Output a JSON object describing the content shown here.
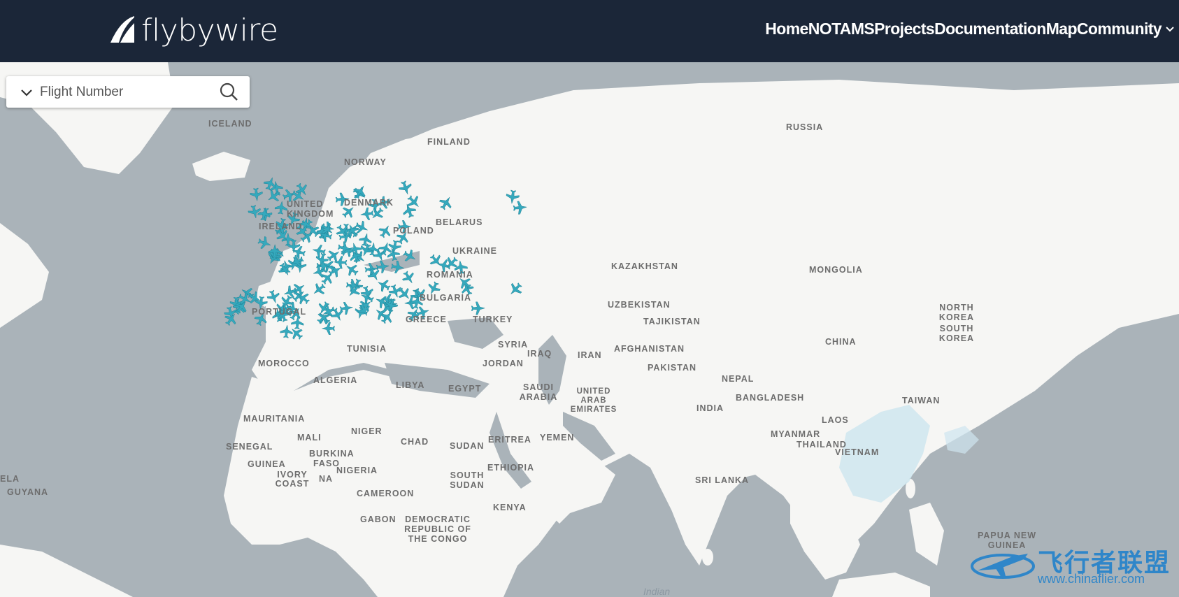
{
  "brand": {
    "name": "flybywire"
  },
  "nav": {
    "items": [
      "Home",
      "NOTAMS",
      "Projects",
      "Documentation",
      "Map",
      "Community"
    ]
  },
  "search": {
    "placeholder": "Flight Number",
    "value": ""
  },
  "map": {
    "labels": {
      "iceland": "ICELAND",
      "finland": "FINLAND",
      "norway": "NORWAY",
      "russia": "RUSSIA",
      "belarus": "BELARUS",
      "ukraine": "UKRAINE",
      "kazakhstan": "KAZAKHSTAN",
      "mongolia": "MONGOLIA",
      "uzbekistan": "UZBEKISTAN",
      "tajikistan": "TAJIKISTAN",
      "turkey": "TURKEY",
      "greece": "GREECE",
      "bulgaria": "BULGARIA",
      "denmark": "DENMARK",
      "poland": "POLAND",
      "ireland": "IRELAND",
      "portugal": "PORTUGAL",
      "united_kingdom": "UNITED KINGDOM",
      "romania": "ROMANIA",
      "north_korea": "NORTH KOREA",
      "south_korea": "SOUTH KOREA",
      "china": "CHINA",
      "tunisia": "TUNISIA",
      "syria": "SYRIA",
      "iraq": "IRAQ",
      "iran": "IRAN",
      "afghanistan": "AFGHANISTAN",
      "pakistan": "PAKISTAN",
      "morocco": "MOROCCO",
      "jordan": "JORDAN",
      "algeria": "ALGERIA",
      "libya": "LIBYA",
      "egypt": "EGYPT",
      "saudi_arabia": "SAUDI ARABIA",
      "nepal": "NEPAL",
      "uae": "UNITED ARAB EMIRATES",
      "bangladesh": "BANGLADESH",
      "taiwan": "TAIWAN",
      "india": "INDIA",
      "mauritania": "MAURITANIA",
      "niger": "NIGER",
      "mali": "MALI",
      "chad": "CHAD",
      "sudan": "SUDAN",
      "eritrea": "ERITREA",
      "yemen": "YEMEN",
      "laos": "LAOS",
      "myanmar": "MYANMAR",
      "thailand": "THAILAND",
      "senegal": "SENEGAL",
      "burkina_faso": "BURKINA FASO",
      "guinea": "GUINEA",
      "vietnam": "VIETNAM",
      "nigeria": "NIGERIA",
      "ethiopia": "ETHIOPIA",
      "ivory_coast": "IVORY COAST",
      "ghana": "NA",
      "south_sudan": "SOUTH SUDAN",
      "sri_lanka": "SRI LANKA",
      "venezuela": "ELA",
      "guyana": "GUYANA",
      "cameroon": "CAMEROON",
      "kenya": "KENYA",
      "gabon": "GABON",
      "drc": "DEMOCRATIC REPUBLIC OF THE CONGO",
      "papua_new_guinea": "PAPUA NEW GUINEA",
      "indian_ocean": "Indian"
    }
  },
  "colors": {
    "header_bg": "#1b2638",
    "plane": "#35a9bd",
    "land": "#f6f6f4",
    "sea": "#aab3b9"
  },
  "icons": {
    "logo": "flybywire-tail-icon",
    "caret": "chevron-down-icon",
    "search_chevron": "chevron-down-icon",
    "search": "search-icon",
    "aircraft": "airplane-icon"
  },
  "watermark": {
    "title": "飞行者联盟",
    "url": "www.chinaflier.com"
  }
}
